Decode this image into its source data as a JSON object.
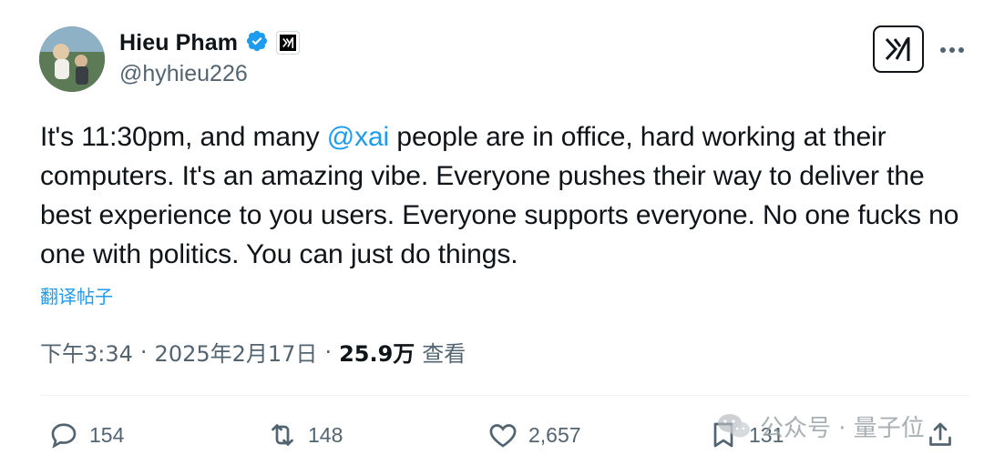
{
  "author": {
    "display_name": "Hieu Pham",
    "handle": "@hyhieu226"
  },
  "icons": {
    "verified": "verified-badge-icon",
    "affiliation": "xai-logo-icon",
    "grok": "grok-icon",
    "more": "more-options-icon",
    "reply": "reply-icon",
    "retweet": "retweet-icon",
    "like": "like-icon",
    "bookmark": "bookmark-icon",
    "share": "share-icon",
    "watermark": "wechat-icon"
  },
  "colors": {
    "accent": "#1d9bf0",
    "text": "#0f1419",
    "secondary": "#536471"
  },
  "tweet": {
    "text_before": "It's 11:30pm, and many ",
    "mention": "@xai",
    "text_after": " people are in office, hard working at their computers. It's an amazing vibe. Everyone pushes their way to deliver the best experience to you users. Everyone supports everyone. No one fucks no one with politics. You can just do things.",
    "translate_label": "翻译帖子"
  },
  "meta": {
    "time": "下午3:34",
    "sep1": "·",
    "date": "2025年2月17日",
    "sep2": "·",
    "views_count": "25.9万",
    "views_label": "查看"
  },
  "actions": {
    "replies": "154",
    "retweets": "148",
    "likes": "2,657",
    "bookmarks": "131"
  },
  "watermark": {
    "text": "公众号 · 量子位"
  }
}
